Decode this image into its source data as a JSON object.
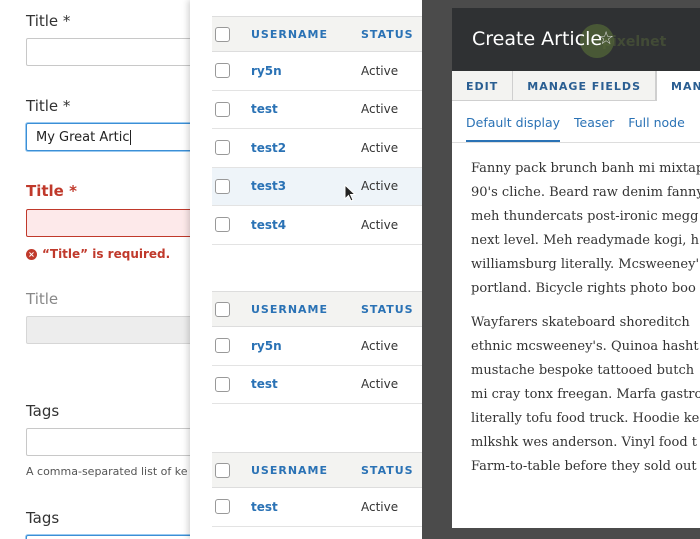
{
  "form": {
    "title_label_1": "Title *",
    "title_label_2": "Title *",
    "title_value_2": "My Great Artic",
    "title_label_error": "Title *",
    "error_message": "“Title” is required.",
    "title_label_disabled": "Title",
    "tags_label_1": "Tags",
    "tags_description": "A comma-separated list of ke",
    "tags_label_2": "Tags"
  },
  "tables": {
    "header_username": "USERNAME",
    "header_status": "STATUS",
    "table1": [
      {
        "username": "ry5n",
        "status": "Active"
      },
      {
        "username": "test",
        "status": "Active"
      },
      {
        "username": "test2",
        "status": "Active"
      },
      {
        "username": "test3",
        "status": "Active"
      },
      {
        "username": "test4",
        "status": "Active"
      }
    ],
    "table2": [
      {
        "username": "ry5n",
        "status": "Active"
      },
      {
        "username": "test",
        "status": "Active"
      }
    ],
    "table3": [
      {
        "username": "test",
        "status": "Active"
      }
    ]
  },
  "modal": {
    "title": "Create Article",
    "watermark": "pixelnet",
    "tabs": [
      "EDIT",
      "MANAGE FIELDS",
      "MANA"
    ],
    "subtabs": [
      "Default display",
      "Teaser",
      "Full node"
    ],
    "paragraph1": [
      "Fanny pack brunch banh mi mixtap",
      "90's cliche. Beard raw denim fanny",
      "meh thundercats post-ironic megg",
      "next level. Meh readymade kogi, h",
      "williamsburg literally. Mcsweeney'",
      "portland. Bicycle rights photo boo"
    ],
    "paragraph2": [
      "Wayfarers skateboard shoreditch",
      "ethnic mcsweeney's. Quinoa hasht",
      "mustache bespoke tattooed butch",
      "mi cray tonx freegan. Marfa gastro",
      "literally tofu food truck. Hoodie ke",
      "mlkshk wes anderson. Vinyl food t",
      "Farm-to-table before they sold out"
    ]
  },
  "colors": {
    "link": "#2a72b5",
    "error": "#c0392b",
    "dark_backdrop": "#4b4b4b",
    "modal_header": "#2f3133"
  }
}
